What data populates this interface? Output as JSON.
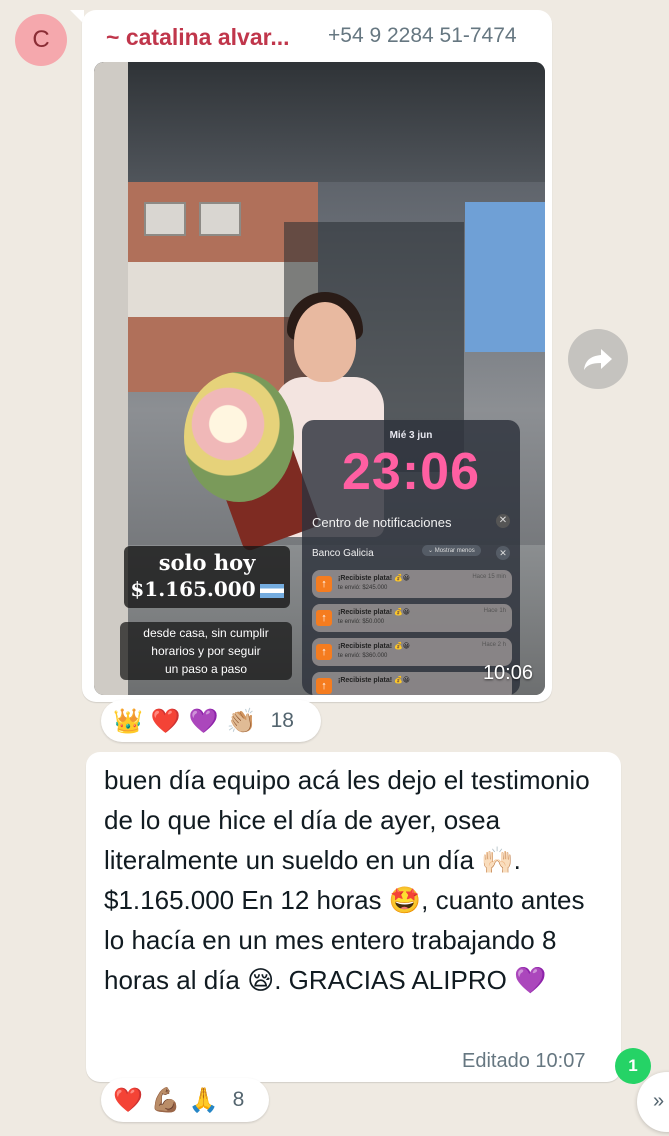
{
  "sender": {
    "avatar_initial": "C",
    "name": "~ catalina alvar...",
    "phone": "+54 9 2284 51-7474"
  },
  "media": {
    "overlay_title_line1": "solo hoy",
    "overlay_title_line2": "$1.165.000",
    "overlay_subtitle_line1": "desde casa, sin cumplir",
    "overlay_subtitle_line2": "horarios y por seguir",
    "overlay_subtitle_line3": "un paso a paso",
    "time": "10:06",
    "lockscreen": {
      "date": "Mié 3 jun",
      "time": "23:06",
      "notification_center": "Centro de notificaciones",
      "app": "Banco Galicia",
      "show_less": "Mostrar menos",
      "notifications": [
        {
          "title": "¡Recibiste plata! 💰😀",
          "body": "te envió: $245.000",
          "time": "Hace 15 min"
        },
        {
          "title": "¡Recibiste plata! 💰😀",
          "body": "te envió: $50.000",
          "time": "Hace 1h"
        },
        {
          "title": "¡Recibiste plata! 💰😀",
          "body": "te envió: $360.000",
          "time": "Hace 2 h"
        },
        {
          "title": "¡Recibiste plata! 💰😀",
          "body": "",
          "time": ""
        }
      ]
    }
  },
  "reactions_1": {
    "emojis": [
      "👑",
      "❤️",
      "💜",
      "👏🏼"
    ],
    "count": "18"
  },
  "message": {
    "text_part1": "buen día equipo acá les dejo el testimonio de lo que hice el día de ayer, osea literalmente un sueldo en un día ",
    "emoji1": "🙌🏻",
    "text_part2": ". $1.165.000 En 12 horas ",
    "emoji2": "🤩",
    "text_part3": ", cuanto antes lo hacía en un mes entero trabajando 8 horas al día ",
    "emoji3": "😪",
    "text_part4": ". GRACIAS ALIPRO ",
    "emoji4": "💜",
    "edited": "Editado 10:07"
  },
  "reactions_2": {
    "emojis": [
      "❤️",
      "💪🏽",
      "🙏"
    ],
    "count": "8"
  },
  "unread_count": "1",
  "colors": {
    "background": "#efeae2",
    "sender_name": "#c0364b",
    "unread_badge": "#25d366"
  }
}
